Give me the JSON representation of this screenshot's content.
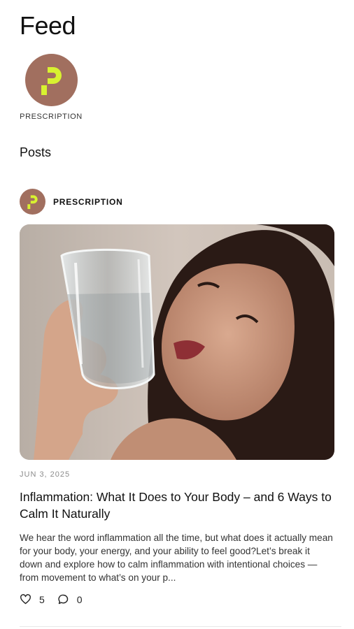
{
  "header": {
    "title": "Feed"
  },
  "brand": {
    "name": "PRESCRIPTION",
    "logo_icon": "prescription-logo-icon",
    "logo_bg": "#a16f5f",
    "logo_fg": "#d8f230"
  },
  "posts_section": {
    "title": "Posts"
  },
  "post": {
    "author": "PRESCRIPTION",
    "image_description_icon": "woman-holding-water-glass-photo",
    "date": "JUN 3, 2025",
    "title": "Inflammation: What It Does to Your Body – and 6 Ways to Calm It Naturally",
    "excerpt": "We hear the word inflammation all the time, but what does it actually mean for your body, your energy, and your ability to feel good?Let’s break it down and explore how to calm inflammation with intentional choices — from movement to what’s on your p...",
    "likes": "5",
    "comments": "0",
    "like_icon": "heart-icon",
    "comment_icon": "comment-bubble-icon"
  }
}
